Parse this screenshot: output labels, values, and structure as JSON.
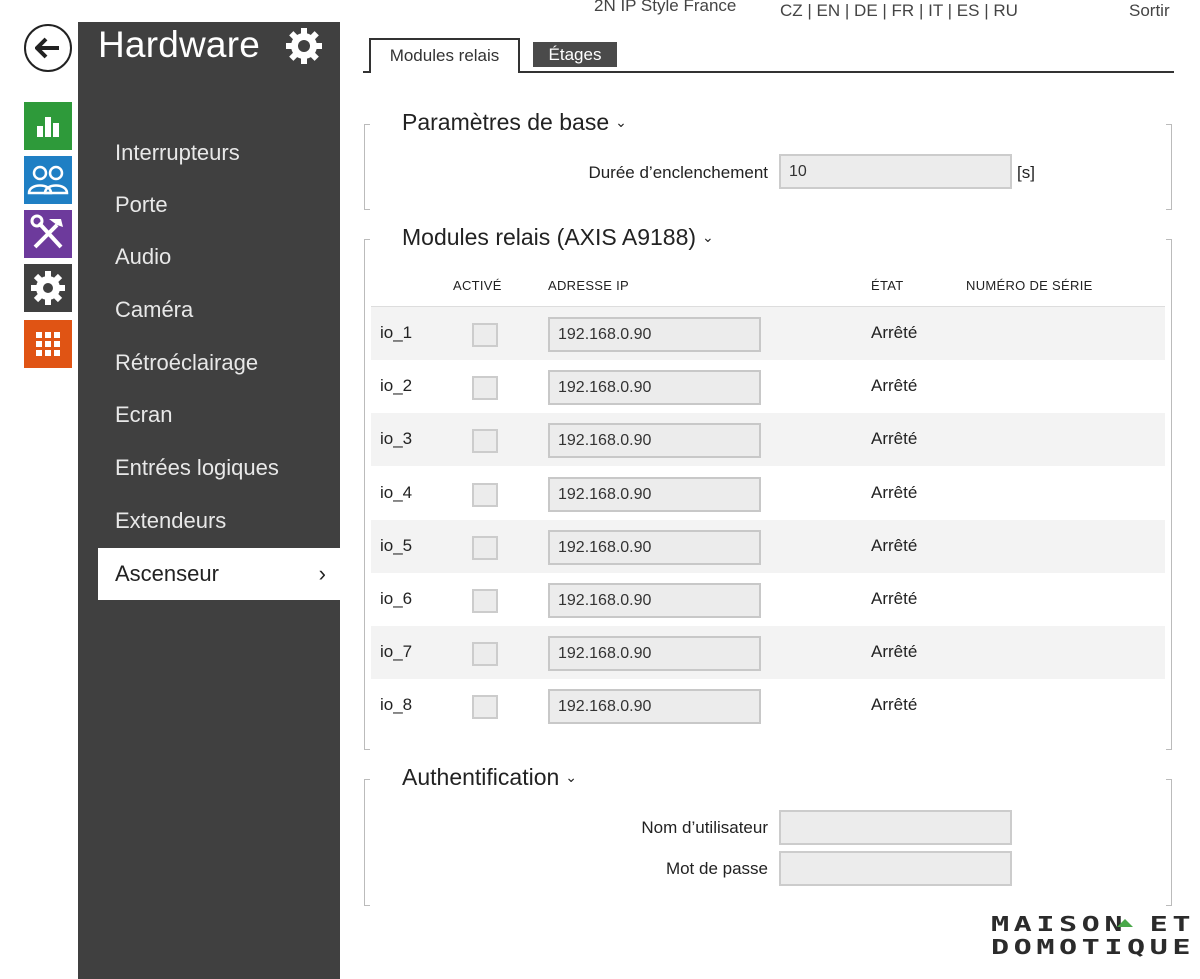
{
  "header": {
    "device_name": "2N IP Style France",
    "languages": [
      "CZ",
      "EN",
      "DE",
      "FR",
      "IT",
      "ES",
      "RU"
    ],
    "logout": "Sortir"
  },
  "rail": {
    "items": [
      {
        "icon": "bar-chart-icon",
        "color": "#2e9a3a"
      },
      {
        "icon": "users-icon",
        "color": "#1f7fc4"
      },
      {
        "icon": "tools-icon",
        "color": "#6d3a9c"
      },
      {
        "icon": "gear-icon",
        "color": "#404040"
      },
      {
        "icon": "grid-icon",
        "color": "#e05414"
      }
    ]
  },
  "sidebar": {
    "title": "Hardware",
    "items": [
      {
        "label": "Interrupteurs"
      },
      {
        "label": "Porte"
      },
      {
        "label": "Audio"
      },
      {
        "label": "Caméra"
      },
      {
        "label": "Rétroéclairage"
      },
      {
        "label": "Ecran"
      },
      {
        "label": "Entrées logiques"
      },
      {
        "label": "Extendeurs"
      },
      {
        "label": "Ascenseur"
      }
    ],
    "active_chevron": "›"
  },
  "tabs": [
    {
      "label": "Modules relais"
    },
    {
      "label": "Étages"
    }
  ],
  "basic": {
    "title": "Paramètres de base",
    "duration_label": "Durée d’enclenchement",
    "duration_value": "10",
    "duration_unit": "[s]"
  },
  "relays": {
    "title": "Modules relais (AXIS A9188)",
    "columns": {
      "active": "ACTIVÉ",
      "ip": "ADRESSE IP",
      "state": "ÉTAT",
      "serial": "NUMÉRO DE SÉRIE"
    },
    "rows": [
      {
        "name": "io_1",
        "ip": "192.168.0.90",
        "state": "Arrêté",
        "active": false
      },
      {
        "name": "io_2",
        "ip": "192.168.0.90",
        "state": "Arrêté",
        "active": false
      },
      {
        "name": "io_3",
        "ip": "192.168.0.90",
        "state": "Arrêté",
        "active": false
      },
      {
        "name": "io_4",
        "ip": "192.168.0.90",
        "state": "Arrêté",
        "active": false
      },
      {
        "name": "io_5",
        "ip": "192.168.0.90",
        "state": "Arrêté",
        "active": false
      },
      {
        "name": "io_6",
        "ip": "192.168.0.90",
        "state": "Arrêté",
        "active": false
      },
      {
        "name": "io_7",
        "ip": "192.168.0.90",
        "state": "Arrêté",
        "active": false
      },
      {
        "name": "io_8",
        "ip": "192.168.0.90",
        "state": "Arrêté",
        "active": false
      }
    ]
  },
  "auth": {
    "title": "Authentification",
    "username_label": "Nom d’utilisateur",
    "username_value": "",
    "password_label": "Mot de passe",
    "password_value": ""
  },
  "watermark": {
    "line1": "MAISON ET",
    "line2": "DOMOTIQUE"
  }
}
